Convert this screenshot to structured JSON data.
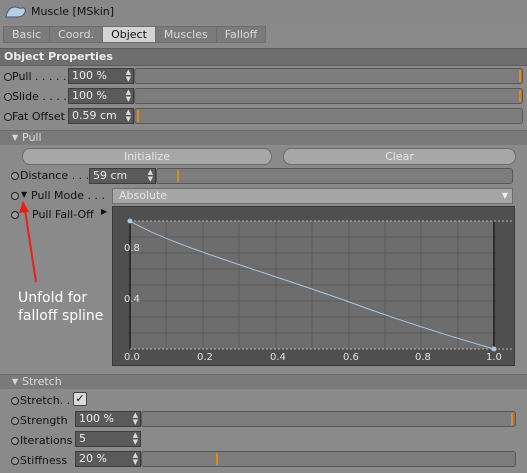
{
  "window": {
    "title": "Muscle [MSkin]"
  },
  "tabs": [
    "Basic",
    "Coord.",
    "Object",
    "Muscles",
    "Falloff"
  ],
  "active_tab": "Object",
  "section_title": "Object Properties",
  "params": {
    "pull": {
      "label": "Pull . . . . .",
      "value": "100 %"
    },
    "slide": {
      "label": "Slide . . . . .",
      "value": "100 %"
    },
    "fat_offset": {
      "label": "Fat Offset",
      "value": "0.59 cm"
    }
  },
  "pull_group": {
    "title": "Pull",
    "initialize_label": "Initialize",
    "clear_label": "Clear",
    "distance": {
      "label": "Distance . . .",
      "value": "59 cm"
    },
    "pull_mode": {
      "label": "Pull Mode . . .",
      "value": "Absolute"
    },
    "pull_falloff_label": "Pull Fall-Off"
  },
  "annotation": {
    "line1": "Unfold for",
    "line2": "falloff spline"
  },
  "graph": {
    "y_ticks": [
      "0.8",
      "0.4",
      "0.0"
    ],
    "x_ticks": [
      "0.0",
      "0.2",
      "0.4",
      "0.6",
      "0.8",
      "1.0"
    ]
  },
  "stretch_group": {
    "title": "Stretch",
    "stretch": {
      "label": "Stretch. .",
      "checked": true,
      "check_glyph": "✓"
    },
    "strength": {
      "label": "Strength",
      "value": "100 %"
    },
    "iterations": {
      "label": "Iterations",
      "value": "5"
    },
    "stiffness": {
      "label": "Stiffness",
      "value": "20 %"
    }
  },
  "colors": {
    "accent": "#e38a12",
    "curve": "#a9c8e6",
    "annotation_arrow": "#e8201c"
  },
  "icons": {
    "logo": "muscle-arm-icon",
    "spinner": "spinner-arrows-icon"
  }
}
